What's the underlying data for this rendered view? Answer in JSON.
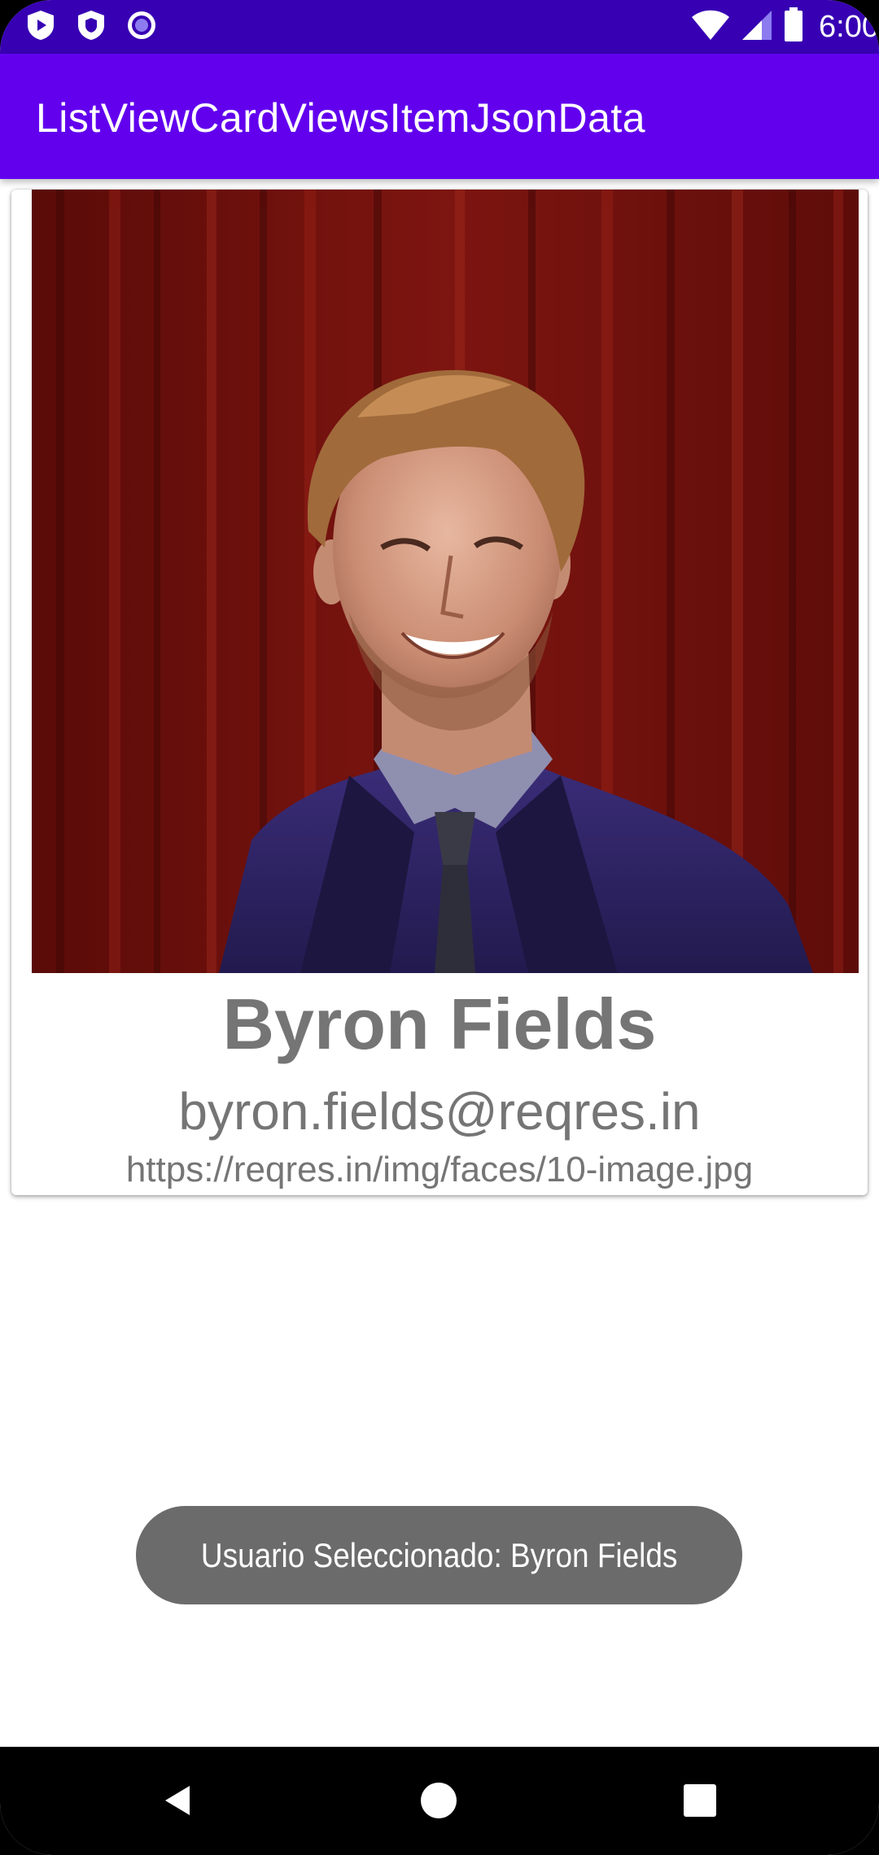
{
  "status_bar": {
    "time": "6:00",
    "background_color": "#3700b3",
    "left_icons": [
      "play-protect-icon",
      "shield-icon",
      "circle-notification-icon"
    ],
    "right_icons": [
      "wifi-icon",
      "signal-icon",
      "battery-icon"
    ]
  },
  "app_bar": {
    "title": "ListViewCardViewsItemJsonData",
    "background_color": "#6200ee"
  },
  "card": {
    "photo": "profile-photo",
    "name": "Byron Fields",
    "email": "byron.fields@reqres.in",
    "avatar_url": "https://reqres.in/img/faces/10-image.jpg"
  },
  "toast": {
    "message": "Usuario Seleccionado: Byron Fields"
  },
  "nav_bar": {
    "buttons": [
      "back-icon",
      "home-icon",
      "recents-icon"
    ]
  }
}
